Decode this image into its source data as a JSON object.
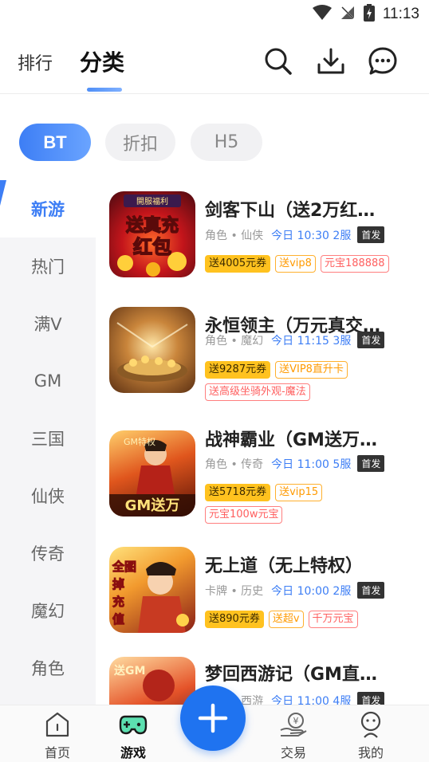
{
  "status_bar": {
    "time": "11:13"
  },
  "header": {
    "tabs": [
      {
        "label": "排行"
      },
      {
        "label": "分类"
      }
    ]
  },
  "filters": [
    {
      "label": "BT",
      "active": true
    },
    {
      "label": "折扣",
      "active": false
    },
    {
      "label": "H5",
      "active": false
    }
  ],
  "sidebar": {
    "items": [
      {
        "label": "新游"
      },
      {
        "label": "热门"
      },
      {
        "label": "满V"
      },
      {
        "label": "GM"
      },
      {
        "label": "三国"
      },
      {
        "label": "仙侠"
      },
      {
        "label": "传奇"
      },
      {
        "label": "魔幻"
      },
      {
        "label": "角色"
      }
    ]
  },
  "games": [
    {
      "title": "剑客下山（送2万红…",
      "genre": "角色 • 仙侠",
      "open": "今日 10:30 2服",
      "badge": "首发",
      "tags": [
        {
          "text": "送4005元券",
          "style": "coupon"
        },
        {
          "text": "送vip8",
          "style": "gold"
        },
        {
          "text": "元宝188888",
          "style": "red"
        }
      ],
      "icon_text": "送真充红包",
      "icon_subtext": "開服福利"
    },
    {
      "title": "永恒领主（万元真交…",
      "genre": "角色 • 魔幻",
      "open": "今日 11:15 3服",
      "badge": "首发",
      "tags": [
        {
          "text": "送9287元券",
          "style": "coupon"
        },
        {
          "text": "送VIP8直升卡",
          "style": "gold"
        },
        {
          "text": "送高级坐骑外观-魔法",
          "style": "red"
        }
      ]
    },
    {
      "title": "战神霸业（GM送万…",
      "genre": "角色 • 传奇",
      "open": "今日 11:00 5服",
      "badge": "首发",
      "tags": [
        {
          "text": "送5718元券",
          "style": "coupon"
        },
        {
          "text": "送vip15",
          "style": "gold"
        },
        {
          "text": "元宝100w元宝",
          "style": "red"
        }
      ],
      "icon_text": "GM送万",
      "icon_subtext": "GM特权"
    },
    {
      "title": "无上道（无上特权）",
      "genre": "卡牌 • 历史",
      "open": "今日 10:00 2服",
      "badge": "首发",
      "tags": [
        {
          "text": "送890元券",
          "style": "coupon"
        },
        {
          "text": "送超v",
          "style": "gold"
        },
        {
          "text": "千万元宝",
          "style": "red"
        }
      ],
      "icon_text": "全图掉充值"
    },
    {
      "title": "梦回西游记（GM直…",
      "genre": "角色 • 西游",
      "open": "今日 11:00 4服",
      "badge": "首发",
      "tags": [],
      "icon_text": "送GM"
    }
  ],
  "bottom_nav": [
    {
      "label": "首页",
      "icon": "home-icon"
    },
    {
      "label": "游戏",
      "icon": "gamepad-icon"
    },
    {
      "label": "交易",
      "icon": "trade-icon"
    },
    {
      "label": "我的",
      "icon": "profile-icon"
    }
  ],
  "colors": {
    "accent": "#3d7ef5",
    "fab": "#1f73f0",
    "coupon": "#ffc21f",
    "gold_tag": "#ff9a00",
    "red_tag": "#ff5f5f"
  }
}
